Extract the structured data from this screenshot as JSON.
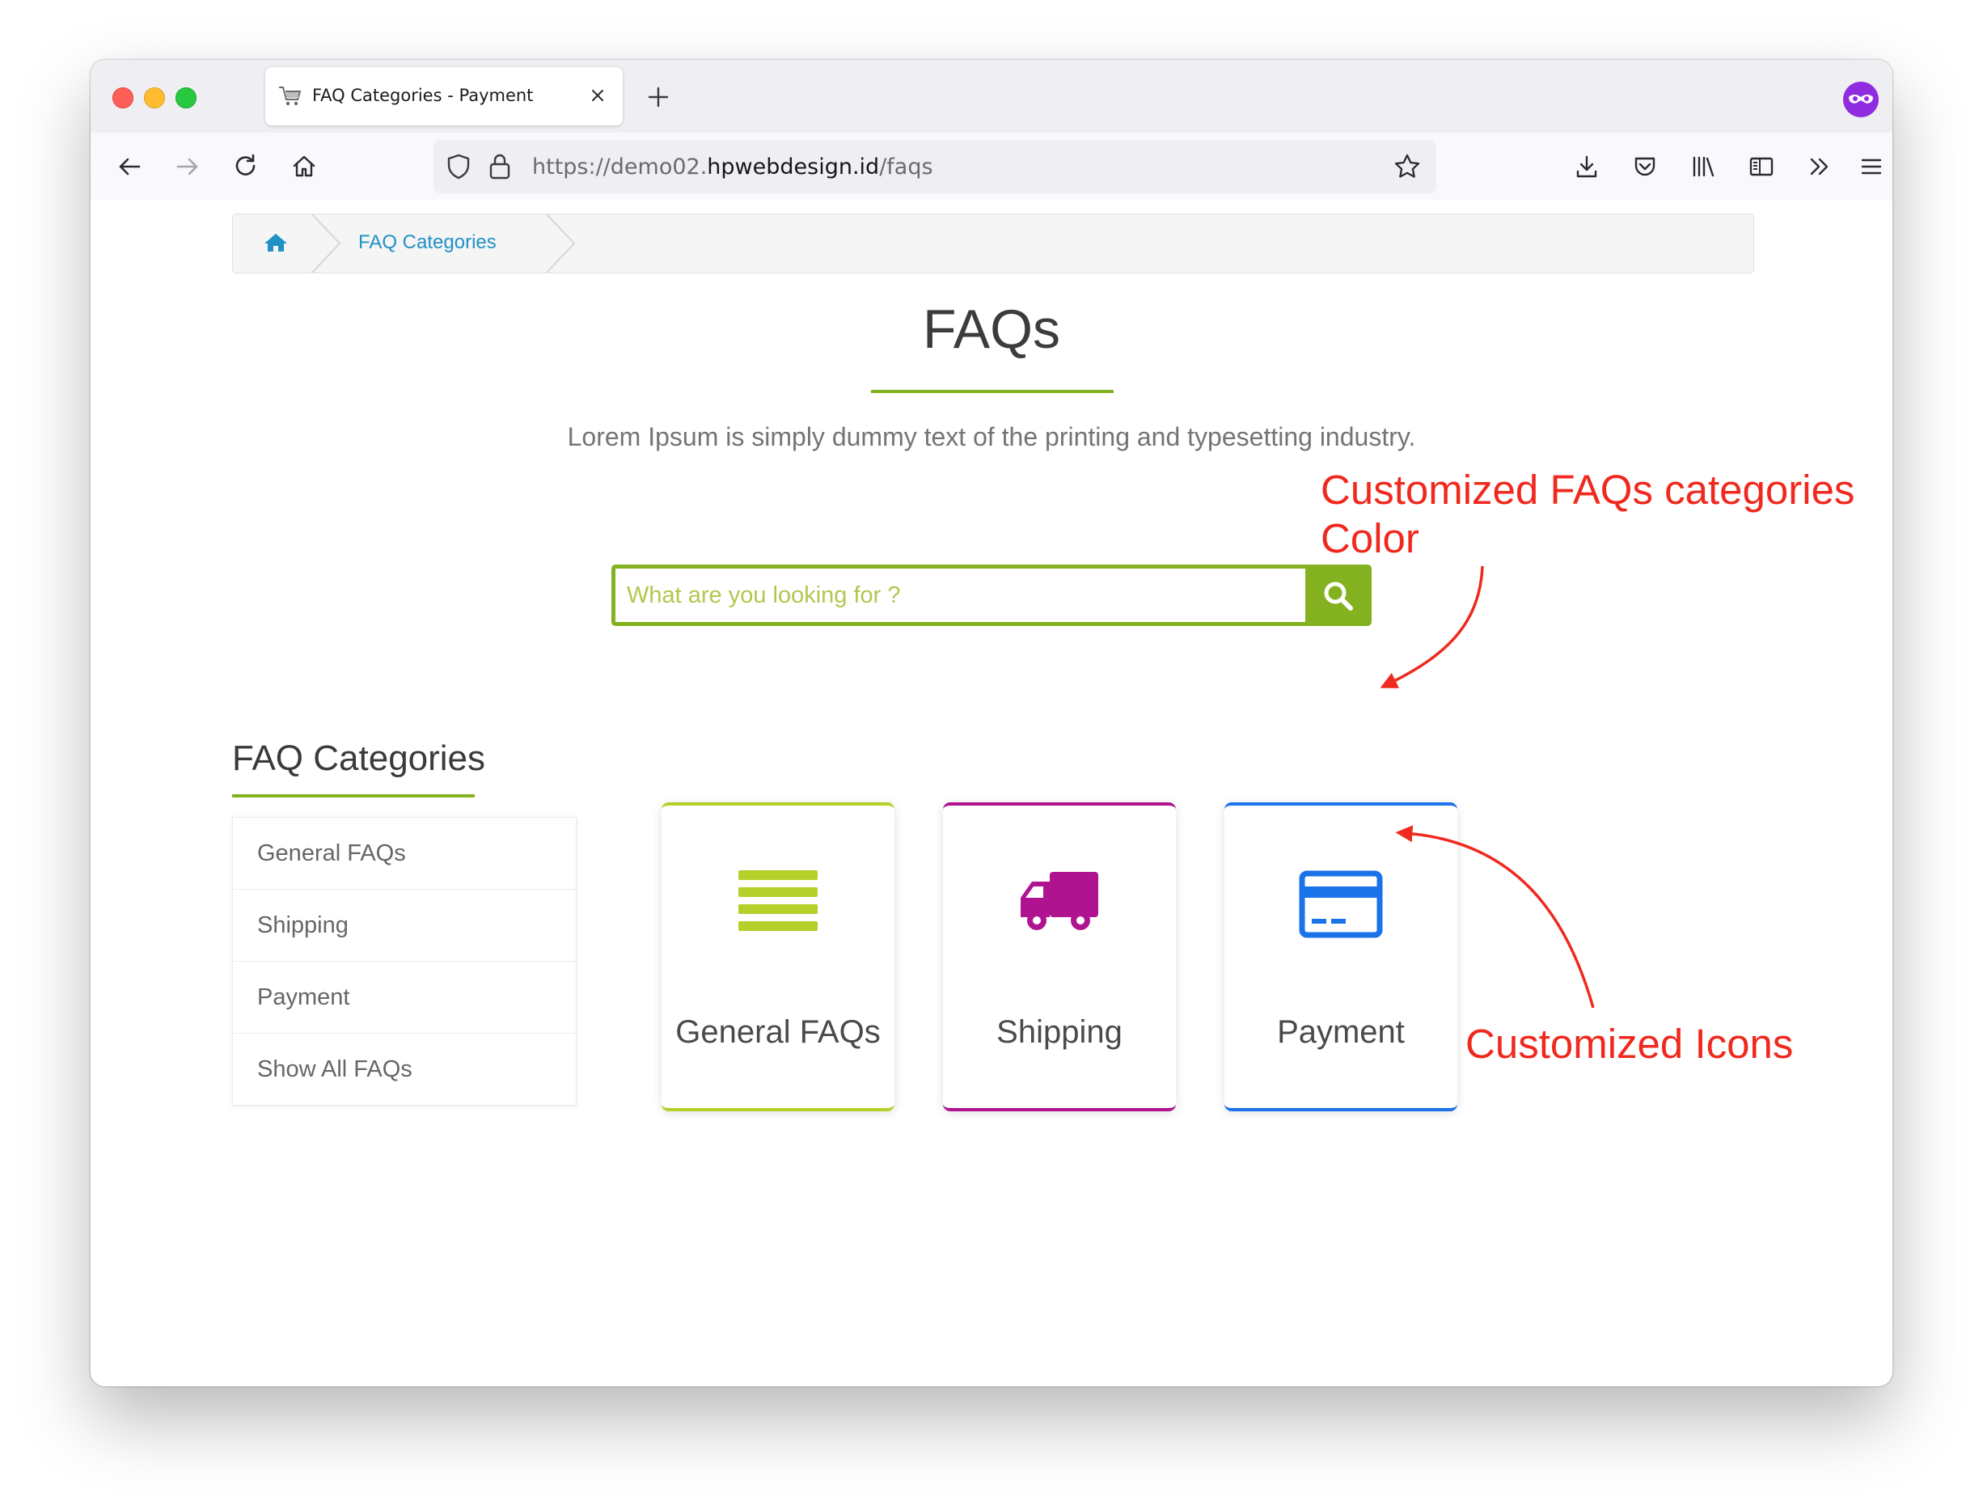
{
  "browser": {
    "tab_title": "FAQ Categories - Payment",
    "url_prefix": "https://demo02.",
    "url_domain": "hpwebdesign.id",
    "url_path": "/faqs"
  },
  "breadcrumb": {
    "link_label": "FAQ Categories"
  },
  "page": {
    "title": "FAQs",
    "subtitle": "Lorem Ipsum is simply dummy text of the printing and typesetting industry."
  },
  "search": {
    "placeholder": "What are you looking for ?"
  },
  "sidebar": {
    "heading": "FAQ Categories",
    "items": [
      {
        "label": "General FAQs"
      },
      {
        "label": "Shipping"
      },
      {
        "label": "Payment"
      },
      {
        "label": "Show All FAQs"
      }
    ]
  },
  "cards": [
    {
      "label": "General FAQs",
      "color": "#b5cf2b",
      "icon": "bars-icon"
    },
    {
      "label": "Shipping",
      "color": "#b0138f",
      "icon": "truck-icon"
    },
    {
      "label": "Payment",
      "color": "#1a73e8",
      "icon": "credit-card-icon"
    }
  ],
  "annotations": {
    "categories_color": [
      "Customized FAQs categories",
      "Color"
    ],
    "icons": "Customized Icons"
  },
  "colors": {
    "accent": "#83b11f",
    "annotation": "#f0291e",
    "link": "#1f91c4"
  }
}
